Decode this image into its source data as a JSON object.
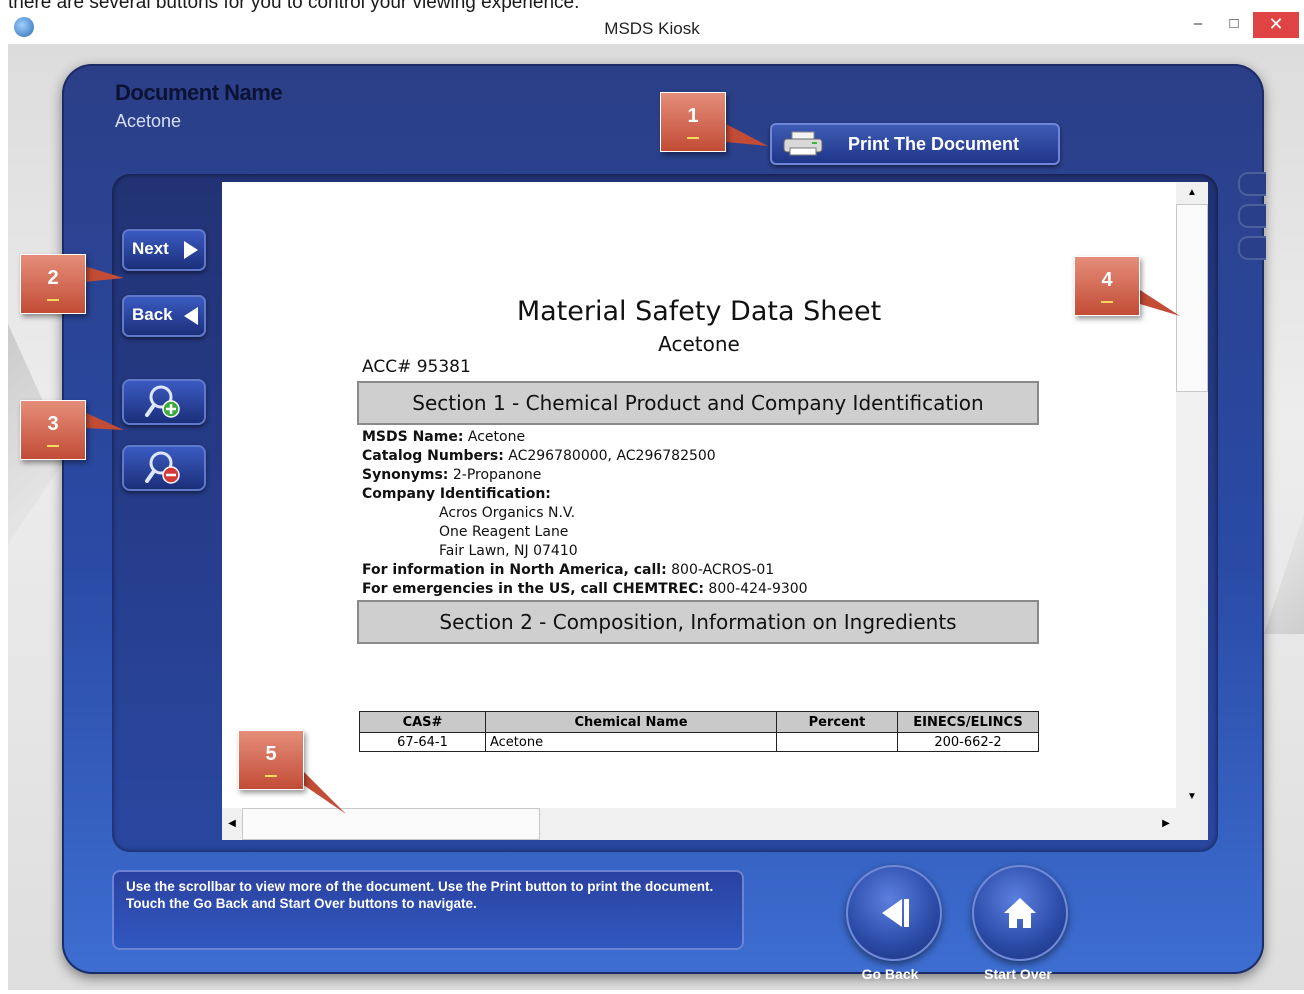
{
  "instruction_caption": "there are several buttons for you to control your viewing experience.",
  "window": {
    "title": "MSDS Kiosk",
    "minimize_glyph": "–",
    "maximize_glyph": "□",
    "close_glyph": "✕"
  },
  "header": {
    "document_label": "Document Name",
    "document_value": "Acetone",
    "print_button": "Print The Document",
    "print_icon": "printer-icon"
  },
  "nav": {
    "next_label": "Next",
    "back_label": "Back",
    "zoom_in_icon": "zoom-in-icon",
    "zoom_out_icon": "zoom-out-icon"
  },
  "document": {
    "title": "Material Safety Data Sheet",
    "subtitle": "Acetone",
    "acc": "ACC# 95381",
    "section1": "Section 1 - Chemical Product and Company Identification",
    "msds_name_label": "MSDS Name:",
    "msds_name_value": "Acetone",
    "catalog_label": "Catalog Numbers:",
    "catalog_value": "AC296780000, AC296782500",
    "synonyms_label": "Synonyms:",
    "synonyms_value": "2-Propanone",
    "company_label": "Company Identification:",
    "company_line1": "Acros Organics N.V.",
    "company_line2": "One Reagent Lane",
    "company_line3": "Fair Lawn, NJ 07410",
    "info_na_label": "For information in North America, call:",
    "info_na_value": "800-ACROS-01",
    "emergency_label": "For emergencies in the US, call CHEMTREC:",
    "emergency_value": "800-424-9300",
    "section2": "Section 2 - Composition, Information on Ingredients",
    "table": {
      "headers": [
        "CAS#",
        "Chemical Name",
        "Percent",
        "EINECS/ELINCS"
      ],
      "rows": [
        [
          "67-64-1",
          "Acetone",
          "",
          "200-662-2"
        ]
      ]
    }
  },
  "callouts": [
    "1",
    "2",
    "3",
    "4",
    "5"
  ],
  "footer": {
    "help_text": "Use the scrollbar to view more of the document. Use the Print button to print the document. Touch the Go Back and Start Over buttons to navigate.",
    "go_back_label": "Go Back",
    "start_over_label": "Start Over",
    "go_back_icon": "go-back-icon",
    "start_over_icon": "home-icon"
  },
  "colors": {
    "panel_blue": "#2a4aa5",
    "callout_red": "#c24c36",
    "close_red": "#e04343"
  }
}
